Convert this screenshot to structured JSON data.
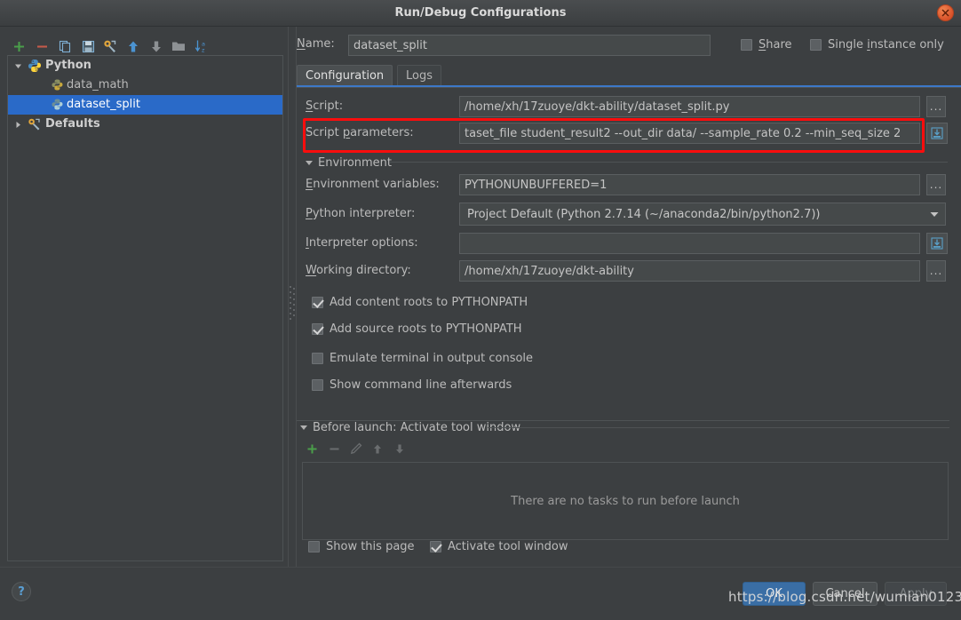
{
  "window": {
    "title": "Run/Debug Configurations",
    "close_icon": "close-icon"
  },
  "left_panel": {
    "toolbar": [
      {
        "name": "add-configuration",
        "icon": "plus-icon",
        "color": "#4a9e4a"
      },
      {
        "name": "remove-configuration",
        "icon": "minus-icon",
        "color": "#c45a4a"
      },
      {
        "name": "copy-configuration",
        "icon": "copy-icon",
        "color": "#5f9fd0"
      },
      {
        "name": "save-configuration",
        "icon": "save-icon",
        "color": "#5f9fd0"
      },
      {
        "name": "edit-defaults",
        "icon": "wrench-icon",
        "color": "#d9a13a"
      },
      {
        "name": "move-up",
        "icon": "arrow-up-icon",
        "color": "#4b93d1"
      },
      {
        "name": "move-down",
        "icon": "arrow-down-icon",
        "color": "#8d9194"
      },
      {
        "name": "move-into-folder",
        "icon": "folder-icon",
        "color": "#8d9194"
      },
      {
        "name": "sort-alphabetically",
        "icon": "sort-az-icon",
        "color": "#4b93d1"
      }
    ],
    "tree": [
      {
        "label": "Python",
        "type": "group",
        "expanded": true,
        "icon": "python-icon",
        "indent": 0,
        "selected": false
      },
      {
        "label": "data_math",
        "type": "leaf",
        "icon": "python-config-icon",
        "indent": 1,
        "selected": false
      },
      {
        "label": "dataset_split",
        "type": "leaf",
        "icon": "python-config-icon",
        "indent": 1,
        "selected": true
      },
      {
        "label": "Defaults",
        "type": "group",
        "expanded": false,
        "icon": "wrench-icon",
        "indent": 0,
        "selected": false
      }
    ]
  },
  "header": {
    "name_label": "Name:",
    "name_value": "dataset_split",
    "share_label": "Share",
    "share_checked": false,
    "single_instance_label": "Single instance only",
    "single_instance_checked": false
  },
  "tabs": [
    {
      "label": "Configuration",
      "active": true
    },
    {
      "label": "Logs",
      "active": false
    }
  ],
  "configuration": {
    "script_label": "Script:",
    "script_value": "/home/xh/17zuoye/dkt-ability/dataset_split.py",
    "script_browse": "...",
    "script_parameters_label": "Script parameters:",
    "script_parameters_value": "taset_file student_result2 --out_dir data/ --sample_rate 0.2 --min_seq_size 2",
    "environment_section_label": "Environment",
    "environment_variables_label": "Environment variables:",
    "environment_variables_value": "PYTHONUNBUFFERED=1",
    "environment_variables_browse": "...",
    "python_interpreter_label": "Python interpreter:",
    "python_interpreter_value": "Project Default (Python 2.7.14 (~/anaconda2/bin/python2.7))",
    "interpreter_options_label": "Interpreter options:",
    "interpreter_options_value": "",
    "working_directory_label": "Working directory:",
    "working_directory_value": "/home/xh/17zuoye/dkt-ability",
    "working_directory_browse": "...",
    "checkboxes": [
      {
        "label": "Add content roots to PYTHONPATH",
        "checked": true
      },
      {
        "label": "Add source roots to PYTHONPATH",
        "checked": true
      },
      {
        "label": "Emulate terminal in output console",
        "checked": false
      },
      {
        "label": "Show command line afterwards",
        "checked": false
      }
    ]
  },
  "before_launch": {
    "section_label": "Before launch: Activate tool window",
    "toolbar": [
      {
        "name": "add-task",
        "icon": "plus-icon",
        "enabled": true
      },
      {
        "name": "remove-task",
        "icon": "minus-icon",
        "enabled": false
      },
      {
        "name": "edit-task",
        "icon": "pencil-icon",
        "enabled": false
      },
      {
        "name": "move-task-up",
        "icon": "arrow-up-icon",
        "enabled": false
      },
      {
        "name": "move-task-down",
        "icon": "arrow-down-icon",
        "enabled": false
      }
    ],
    "empty_text": "There are no tasks to run before launch",
    "show_page_label": "Show this page",
    "show_page_checked": false,
    "activate_tool_window_label": "Activate tool window",
    "activate_tool_window_checked": true
  },
  "footer": {
    "help_label": "?",
    "ok_label": "OK",
    "cancel_label": "Cancel",
    "apply_label": "Apply"
  },
  "watermark": "https://blog.csdn.net/wumian0123",
  "colors": {
    "background": "#3c3f41",
    "selection": "#2a6ac8",
    "accent": "#3c78c8",
    "highlight_box": "#fb0d0d",
    "ok_button": "#3a6ea5",
    "close_button": "#d8522a"
  }
}
